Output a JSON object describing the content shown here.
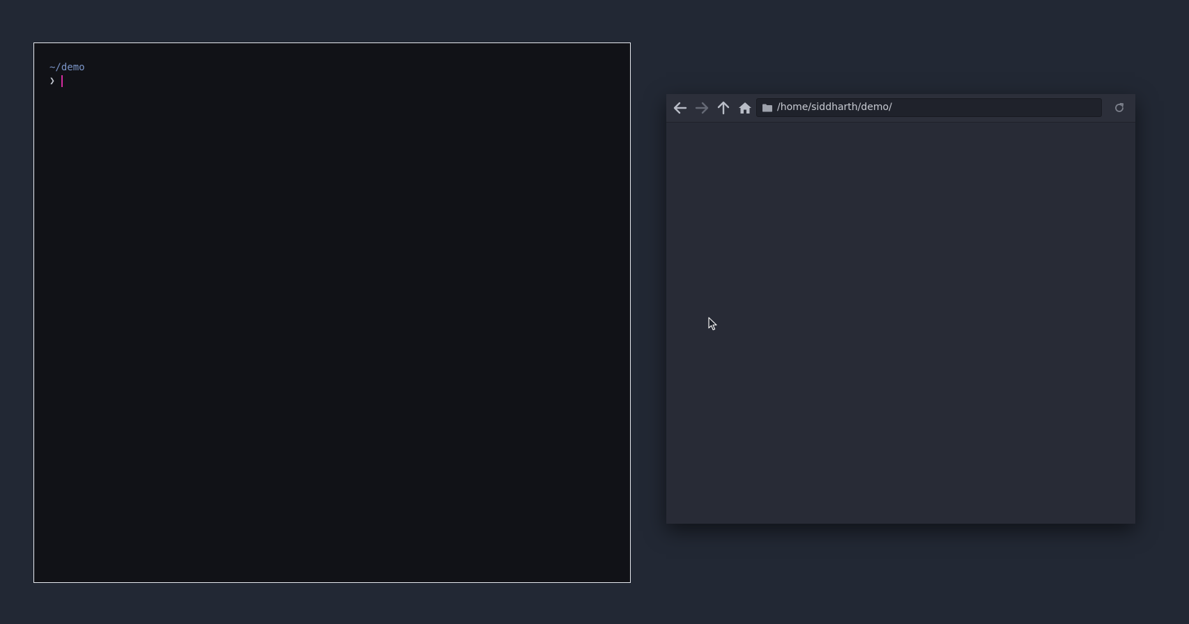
{
  "terminal": {
    "cwd": "~/demo",
    "prompt_symbol": "❯",
    "input": ""
  },
  "file_manager": {
    "path": "/home/siddharth/demo/",
    "toolbar": {
      "back_icon": "arrow-left-icon",
      "forward_icon": "arrow-right-icon",
      "up_icon": "arrow-up-icon",
      "home_icon": "home-icon",
      "folder_icon": "folder-icon",
      "reload_icon": "reload-icon"
    }
  },
  "colors": {
    "desktop_bg": "#222834",
    "terminal_bg": "#111217",
    "terminal_border": "#e8ebf0",
    "cwd": "#7b95c8",
    "cursor": "#d62ca0",
    "file_manager_bg": "#282b36"
  }
}
